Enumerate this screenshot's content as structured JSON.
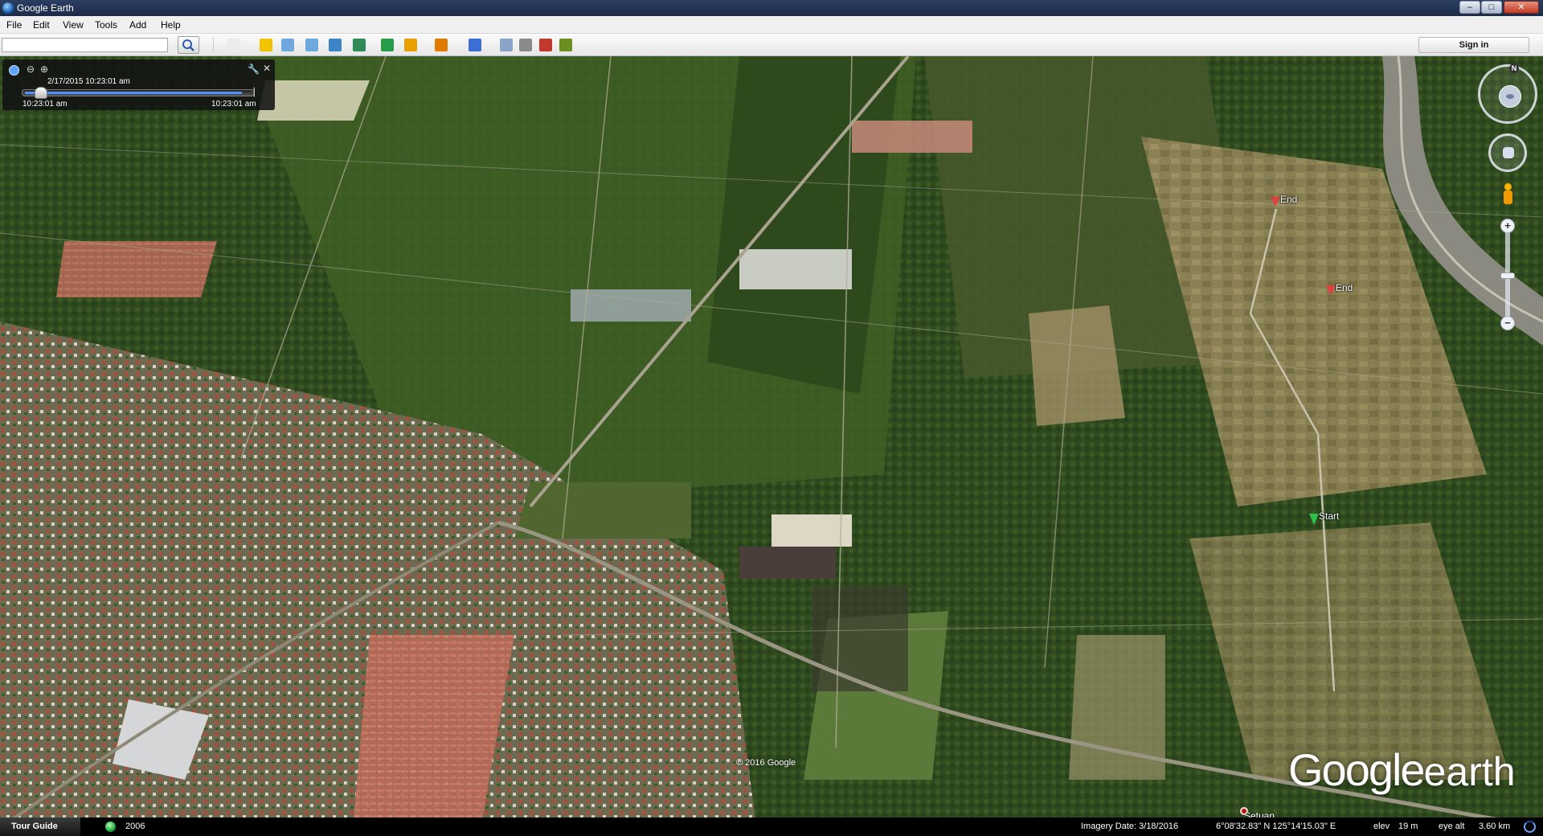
{
  "window": {
    "title": "Google Earth",
    "controls": [
      "–",
      "□",
      "✕"
    ]
  },
  "menu": [
    "File",
    "Edit",
    "View",
    "Tools",
    "Add",
    "Help"
  ],
  "toolbar": {
    "search_value": "",
    "buttons": [
      {
        "name": "sidebar-toggle",
        "icon": "sidebar-icon",
        "color": "#ececec"
      },
      {
        "name": "add-placemark",
        "icon": "pushpin-icon",
        "color": "#f2c400"
      },
      {
        "name": "add-polygon",
        "icon": "polygon-icon",
        "color": "#6fa8dc"
      },
      {
        "name": "add-path",
        "icon": "path-icon",
        "color": "#6fa8dc"
      },
      {
        "name": "add-image-overlay",
        "icon": "image-overlay-icon",
        "color": "#3d85c6"
      },
      {
        "name": "record-tour",
        "icon": "record-tour-icon",
        "color": "#2e8b57"
      },
      {
        "name": "historical-imagery",
        "icon": "clock-icon",
        "color": "#2a9d4a"
      },
      {
        "name": "sunlight",
        "icon": "sun-icon",
        "color": "#e8a000"
      },
      {
        "name": "switch-planet",
        "icon": "planet-icon",
        "color": "#e07b00"
      },
      {
        "name": "ruler",
        "icon": "ruler-icon",
        "color": "#3b6fd6"
      },
      {
        "name": "email",
        "icon": "email-icon",
        "color": "#8aa4c8"
      },
      {
        "name": "print",
        "icon": "print-icon",
        "color": "#8a8a8a"
      },
      {
        "name": "save-image",
        "icon": "save-image-icon",
        "color": "#c0392b"
      },
      {
        "name": "view-in-maps",
        "icon": "maps-icon",
        "color": "#6b8e23"
      }
    ],
    "signin_label": "Sign in"
  },
  "time_slider": {
    "current": "2/17/2015  10:23:01 am",
    "start_label": "10:23:01 am",
    "end_label": "10:23:01 am",
    "position": 0.06
  },
  "navigation": {
    "north_label": "N",
    "zoom_in": "+",
    "zoom_out": "−",
    "zoom_mid": "−"
  },
  "placemarks": [
    {
      "label": "End",
      "color": "#e04040"
    },
    {
      "label": "End",
      "color": "#e04040"
    },
    {
      "label": "Start",
      "color": "#2ec24a"
    }
  ],
  "map": {
    "copyright": "© 2016 Google",
    "logo_word1": "Google",
    "logo_word2": "earth",
    "place_label": "Setuan"
  },
  "statusbar": {
    "tour_guide": "Tour Guide",
    "history_year": "2006",
    "imagery_date": "Imagery Date: 3/18/2016",
    "coords": "6°08'32.83\" N  125°14'15.03\" E",
    "elev_label": "elev",
    "elev_value": "19 m",
    "eye_alt_label": "eye alt",
    "eye_alt_value": "3.60 km"
  }
}
